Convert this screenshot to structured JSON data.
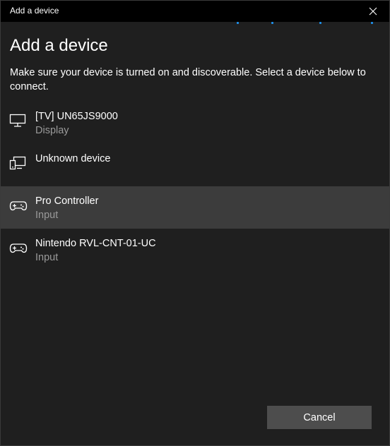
{
  "window": {
    "title": "Add a device"
  },
  "heading": "Add a device",
  "instructions": "Make sure your device is turned on and discoverable. Select a device below to connect.",
  "devices": [
    {
      "name": "[TV] UN65JS9000",
      "type": "Display",
      "icon": "monitor-icon",
      "selected": false
    },
    {
      "name": "Unknown device",
      "type": "",
      "icon": "devices-icon",
      "selected": false
    },
    {
      "name": "Pro Controller",
      "type": "Input",
      "icon": "gamepad-icon",
      "selected": true
    },
    {
      "name": "Nintendo RVL-CNT-01-UC",
      "type": "Input",
      "icon": "gamepad-icon",
      "selected": false
    }
  ],
  "buttons": {
    "cancel": "Cancel"
  },
  "colors": {
    "accent": "#1e8fe8",
    "window_bg": "#1f1f1f",
    "titlebar_bg": "#000000",
    "selected_row": "#3c3c3c",
    "secondary_text": "#9a9a9a",
    "button_bg": "#4d4d4d"
  }
}
